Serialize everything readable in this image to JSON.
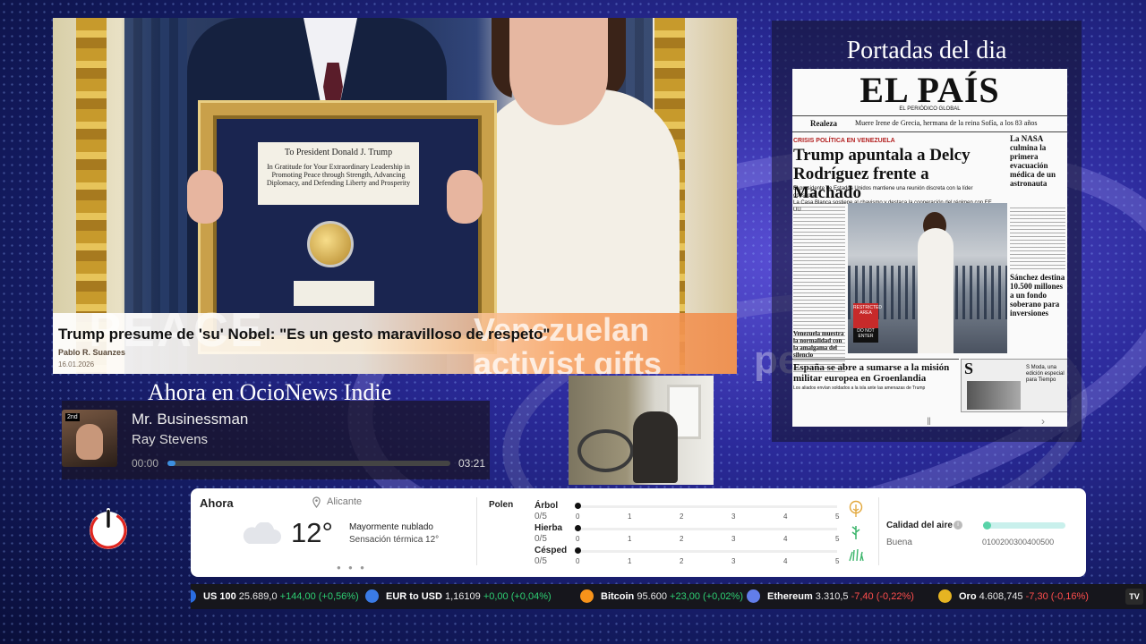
{
  "news": {
    "headline": "Trump presume de 'su' Nobel: \"Es un gesto maravilloso de respeto\"",
    "author": "Pablo R. Suanzes",
    "date": "16.01.2026",
    "big_text": "PEACE",
    "side_text_1": "Venezuelan",
    "side_text_2": "activist gifts Trump",
    "plaque_title": "To President Donald J. Trump",
    "plaque_text": "In Gratitude for Your Extraordinary Leadership in Promoting Peace through Strength, Advancing Diplomacy, and Defending Liberty and Prosperity"
  },
  "now_playing": {
    "heading": "Ahora en OcioNews Indie",
    "song": "Mr. Businessman",
    "artist": "Ray Stevens",
    "time_elapsed": "00:00",
    "time_total": "03:21",
    "progress": 0.03,
    "cover_tag": "2nd"
  },
  "portadas": {
    "title": "Portadas del dia",
    "masthead": "EL PAÍS",
    "subhead": "EL PERIÓDICO GLOBAL",
    "realeza_label": "Realeza",
    "realeza_text": "Muere Irene de Grecia, hermana de la reina Sofía, a los 83 años",
    "kicker": "CRISIS POLÍTICA EN VENEZUELA",
    "main_headline": "Trump apuntala a Delcy Rodríguez frente a Machado",
    "bullet_1": "El presidente de Estados Unidos mantiene una reunión discreta con la líder opositora",
    "bullet_2": "La Casa Blanca sostiene al chavismo y destaca la cooperación del régimen con EE UU",
    "side_headline": "La NASA culmina la primera evacuación médica de un astronauta",
    "sanchez_headline": "Sánchez destina 10.500 millones a un fondo soberano para inversiones",
    "venezuela_small": "Venezuela muestra la normalidad con la amalgama del silencio",
    "bottom_headline": "España se abre a sumarse a la misión militar europea en Groenlandia",
    "bottom_sub": "Los aliados envían soldados a la isla ante las amenazas de Trump",
    "sm_letter": "S",
    "sm_text": "S Moda, una edición especial para Tiempo",
    "sign_text_1": "RESTRICTED AREA",
    "sign_text_2": "DO NOT ENTER"
  },
  "weather": {
    "title": "Ahora",
    "location": "Alicante",
    "temperature": "12°",
    "description": "Mayormente nublado",
    "feels_like": "Sensación térmica 12°",
    "pages_dots": "● ● ●",
    "pollen_label": "Polen",
    "pollen": [
      {
        "name": "Árbol",
        "value": "0/5",
        "level": 0
      },
      {
        "name": "Hierba",
        "value": "0/5",
        "level": 0
      },
      {
        "name": "Césped",
        "value": "0/5",
        "level": 0
      }
    ],
    "pollen_scale": [
      "0",
      "1",
      "2",
      "3",
      "4",
      "5"
    ],
    "air_quality_label": "Calidad del aire",
    "air_quality_level": "Buena",
    "air_quality_value": 0,
    "air_scale": "0100200300400500",
    "info_glyph": "i"
  },
  "ticker": [
    {
      "name": "US 100",
      "value": "25.689,0",
      "change": "+144,00 (+0,56%)",
      "dir": "up",
      "icon_color": "#2a6de0"
    },
    {
      "name": "EUR to USD",
      "value": "1,16109",
      "change": "+0,00 (+0,04%)",
      "dir": "up",
      "icon_color": "#3a7be6"
    },
    {
      "name": "Bitcoin",
      "value": "95.600",
      "change": "+23,00 (+0,02%)",
      "dir": "up",
      "icon_color": "#f7931a"
    },
    {
      "name": "Ethereum",
      "value": "3.310,5",
      "change": "-7,40 (-0,22%)",
      "dir": "down",
      "icon_color": "#627eea"
    },
    {
      "name": "Oro",
      "value": "4.608,745",
      "change": "-7,30 (-0,16%)",
      "dir": "down",
      "icon_color": "#e6b422"
    }
  ],
  "ticker_logo": "TV",
  "colors": {
    "accent_blue": "#3d8fe0",
    "up": "#2ecf73",
    "down": "#ff4d4d",
    "power_red": "#e0261f"
  }
}
